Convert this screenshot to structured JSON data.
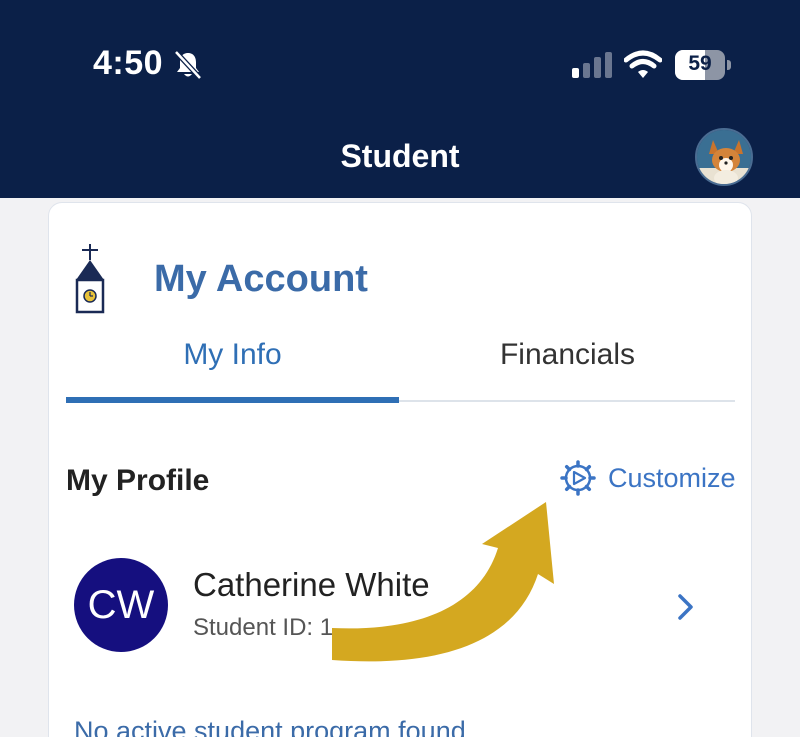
{
  "status_bar": {
    "time": "4:50",
    "battery": "59"
  },
  "header": {
    "title": "Student"
  },
  "account": {
    "title": "My Account"
  },
  "tabs": [
    {
      "label": "My Info",
      "active": true
    },
    {
      "label": "Financials",
      "active": false
    }
  ],
  "profile": {
    "section_title": "My Profile",
    "customize_label": "Customize",
    "initials": "CW",
    "name": "Catherine White",
    "student_id": "Student ID: 1"
  },
  "program": {
    "message": "No active student program found"
  },
  "colors": {
    "header_bg": "#0b2048",
    "accent_blue": "#2f6fb5",
    "avatar_bg": "#150f7f",
    "arrow_gold": "#d4a820"
  }
}
